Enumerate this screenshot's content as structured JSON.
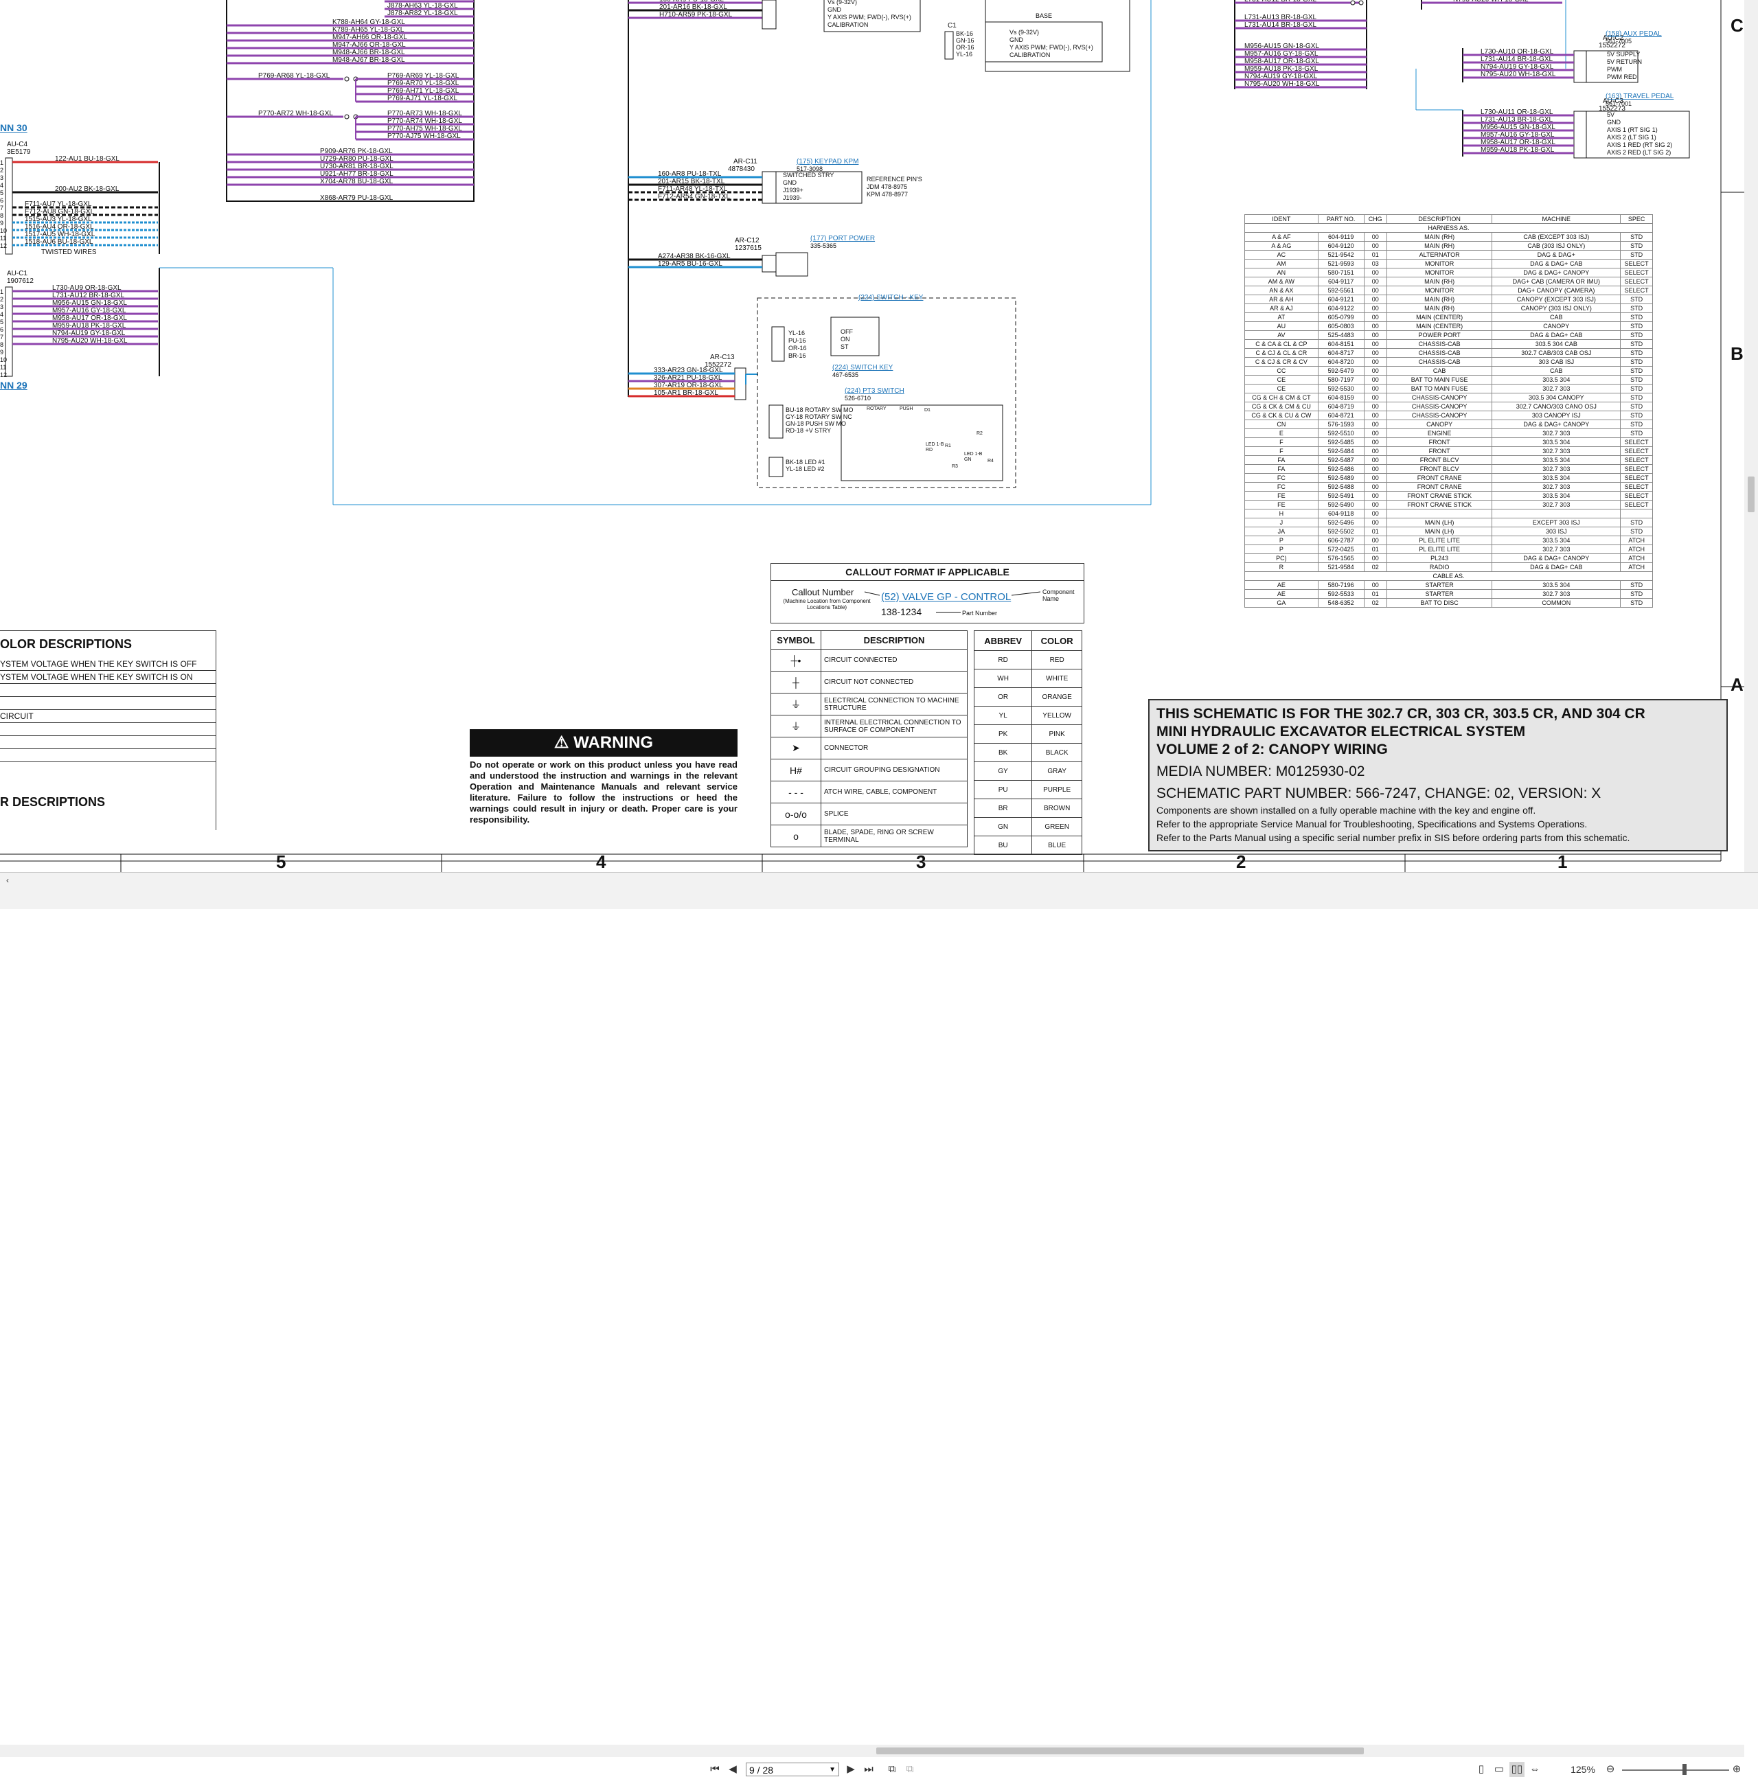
{
  "viewer": {
    "page_current": "9 / 28",
    "zoom": "125%"
  },
  "zones": {
    "columns": [
      "5",
      "4",
      "3",
      "2",
      "1"
    ],
    "rows": [
      "C",
      "B",
      "A"
    ]
  },
  "colors": {
    "purple": "#8e44ad",
    "red": "#d62b2b",
    "blue_wire": "#1f8fd0",
    "orange": "#e08020",
    "link": "#1b73b8"
  },
  "diagram": {
    "conn30": "NN 30",
    "conn29": "NN 29",
    "auc4": {
      "name": "AU-C4",
      "pn": "3E5179"
    },
    "auc1": {
      "name": "AU-C1",
      "pn": "1907612"
    },
    "auc4_wires": [
      "122-AU1 BU-18-GXL",
      "200-AU2 BK-18-GXL",
      "F711-AU7 YL-18-GXL",
      "F712-AU8 GN-18-GXL",
      "1515-AU3 YL-18-GXL",
      "1516-AU4 OR-18-GXL",
      "1517-AU5 WH-18-GXL",
      "1518-AU6 BU-18-GXL"
    ],
    "twisted": "TWISTED WIRES",
    "auc1_wires": [
      "L730-AU9 OR-18-GXL",
      "L731-AU12 BR-18-GXL",
      "M956-AU15 GN-18-GXL",
      "M957-AU16 GY-18-GXL",
      "M958-AU17 OR-18-GXL",
      "M959-AU18 PK-18-GXL",
      "N794-AU19 GY-18-GXL",
      "N795-AU20 WH-18-GXL"
    ],
    "bundle_top": [
      "J878-AR62 BR-18-GXL",
      "J878-AH63 YL-18-GXL",
      "J878-AR82 YL-18-GXL"
    ],
    "bundle_k": [
      "K788-AH64 GY-18-GXL",
      "K789-AH65 YL-18-GXL",
      "M947-AH66 OR-18-GXL",
      "M947-AJ66 OR-18-GXL",
      "M948-AJ66 BR-18-GXL",
      "M948-AJ67 BR-18-GXL"
    ],
    "p769_in": "P769-AR68 YL-18-GXL",
    "p769_out": [
      "P769-AR69 YL-18-GXL",
      "P769-AR70 YL-18-GXL",
      "P769-AH71 YL-18-GXL",
      "P769-AJ71 YL-18-GXL"
    ],
    "p770_in": "P770-AR72 WH-18-GXL",
    "p770_out": [
      "P770-AR73 WH-18-GXL",
      "P770-AR74 WH-18-GXL",
      "P770-AH75 WH-18-GXL",
      "P770-AJ75 WH-18-GXL"
    ],
    "bundle_p909": [
      "P909-AR76 PK-18-GXL",
      "U729-AR80 PU-18-GXL",
      "U730-AR81 BR-18-GXL",
      "U921-AH77 BR-18-GXL",
      "X704-AR78 BU-18-GXL"
    ],
    "x868": "X868-AR79 PU-18-GXL",
    "top_mid": [
      "160-AR9 PU-18-GXL",
      "201-AR16 BK-18-GXL",
      "H710-AR59 PK-18-GXL"
    ],
    "top_mid_pins": [
      "Vs (9-32V)",
      "GND",
      "Y AXIS PWM; FWD(-), RVS(+)",
      "CALIBRATION"
    ],
    "c1": "C1",
    "c1_pins": [
      "Vs (9-32V)",
      "GND",
      "Y AXIS PWM; FWD(-), RVS(+)",
      "CALIBRATION"
    ],
    "c1_wires": [
      "BK-16",
      "GN-16",
      "OR-16",
      "YL-16"
    ],
    "base": "BASE",
    "arc11": {
      "name": "AR-C11",
      "pn": "4878430",
      "callout": "(175) KEYPAD KPM",
      "callpn": "517-3098"
    },
    "arc11_wires": [
      "160-AR8 PU-18-TXL",
      "201-AR15 BK-18-TXL",
      "F711-AR48 YL-18-TXL",
      "F712-AR54 GN-18-TXL"
    ],
    "arc11_pins": [
      "SWITCHED STRY",
      "GND",
      "J1939+",
      "J1939-"
    ],
    "ref_pins": [
      "REFERENCE PIN'S",
      "JDM 478-8975",
      "KPM 478-8977"
    ],
    "arc12": {
      "name": "AR-C12",
      "pn": "1237615",
      "callout": "(177) PORT POWER",
      "callpn": "335-5365"
    },
    "arc12_wires": [
      "A274-AR38 BK-16-GXL",
      "129-AR5 BU-16-GXL"
    ],
    "arc13": {
      "name": "AR-C13",
      "pn": "1552272"
    },
    "arc13_wires": [
      "333-AR23 GN-18-GXL",
      "326-AR21 PU-18-GXL",
      "307-AR19 OR-18-GXL",
      "105-AR1 BR-18-GXL"
    ],
    "switch_key_box": "(224) SWITCH - KEY",
    "switch_key": {
      "callout": "(224) SWITCH KEY",
      "pn": "467-6535"
    },
    "switch_key_wires": [
      "YL-16",
      "PU-16",
      "OR-16",
      "BR-16"
    ],
    "switch_key_pos": [
      "OFF",
      "ON",
      "ST"
    ],
    "pt3": {
      "callout": "(224) PT3 SWITCH",
      "pn": "526-6710"
    },
    "pt3_wires": [
      "BU-18 ROTARY SW MO",
      "GY-18 ROTARY SW NC",
      "GN-18 PUSH SW MO",
      "RD-18 +V STRY",
      "BK-18 LED #1",
      "YL-18 LED #2"
    ],
    "pt3_labels": [
      "ROTARY",
      "PUSH",
      "R1",
      "R2",
      "R3",
      "R4",
      "D1",
      "LED 1-B RD",
      "LED 1-B GN"
    ],
    "auc2": {
      "name": "AU-C2",
      "pn": "1552272",
      "callout": "(158) AUX PEDAL",
      "callpn": "561-7005"
    },
    "auc2_wires": [
      "L730-AU10 OR-18-GXL",
      "L731-AU14 BR-18-GXL",
      "N794-AU19 GY-18-GXL",
      "N795-AU20 WH-18-GXL"
    ],
    "auc2_pins": [
      "5V SUPPLY",
      "5V RETURN",
      "PWM",
      "PWM RED"
    ],
    "auc3": {
      "name": "AU-C3",
      "pn": "1552273",
      "callout": "(163) TRAVEL PEDAL",
      "callpn": "561-7001"
    },
    "auc3_wires": [
      "L730-AU11 OR-18-GXL",
      "L731-AU13 BR-18-GXL",
      "M956-AU15 GN-18-GXL",
      "M957-AU16 GY-18-GXL",
      "M958-AU17 OR-18-GXL",
      "M959-AU18 PK-18-GXL"
    ],
    "auc3_pins": [
      "5V",
      "GND",
      "AXIS 1 (RT SIG 1)",
      "AXIS 2 (LT SIG 1)",
      "AXIS 1 RED (RT SIG 2)",
      "AXIS 2 RED (LT SIG 2)"
    ],
    "top_right_a": [
      "L731-AU12 BR-18-GXL"
    ],
    "top_right_b": "N795-AU20 WH-18-GXL",
    "right_bundle": [
      "L731-AU13 BR-18-GXL",
      "L731-AU14 BR-18-GXL",
      "M956-AU15 GN-18-GXL",
      "M957-AU16 GY-18-GXL",
      "M958-AU17 OR-18-GXL",
      "M959-AU18 PK-18-GXL",
      "N794-AU19 GY-18-GXL",
      "N795-AU20 WH-18-GXL"
    ]
  },
  "parts_table": {
    "headers": [
      "IDENT",
      "PART NO.",
      "CHG",
      "DESCRIPTION",
      "MACHINE",
      "SPEC"
    ],
    "section_harness": "HARNESS AS.",
    "section_cable": "CABLE AS.",
    "harness": [
      [
        "A & AF",
        "604-9119",
        "00",
        "MAIN (RH)",
        "CAB (EXCEPT 303 ISJ)",
        "STD"
      ],
      [
        "A & AG",
        "604-9120",
        "00",
        "MAIN (RH)",
        "CAB (303 ISJ ONLY)",
        "STD"
      ],
      [
        "AC",
        "521-9542",
        "01",
        "ALTERNATOR",
        "DAG & DAG+",
        "STD"
      ],
      [
        "AM",
        "521-9593",
        "03",
        "MONITOR",
        "DAG & DAG+ CAB",
        "SELECT"
      ],
      [
        "AN",
        "580-7151",
        "00",
        "MONITOR",
        "DAG & DAG+ CANOPY",
        "SELECT"
      ],
      [
        "AM & AW",
        "604-9117",
        "00",
        "MAIN (RH)",
        "DAG+ CAB (CAMERA OR IMU)",
        "SELECT"
      ],
      [
        "AN & AX",
        "592-5561",
        "00",
        "MONITOR",
        "DAG+ CANOPY (CAMERA)",
        "SELECT"
      ],
      [
        "AR & AH",
        "604-9121",
        "00",
        "MAIN (RH)",
        "CANOPY (EXCEPT 303 ISJ)",
        "STD"
      ],
      [
        "AR & AJ",
        "604-9122",
        "00",
        "MAIN (RH)",
        "CANOPY (303 ISJ ONLY)",
        "STD"
      ],
      [
        "AT",
        "605-0799",
        "00",
        "MAIN (CENTER)",
        "CAB",
        "STD"
      ],
      [
        "AU",
        "605-0803",
        "00",
        "MAIN (CENTER)",
        "CANOPY",
        "STD"
      ],
      [
        "AV",
        "525-4483",
        "00",
        "POWER PORT",
        "DAG & DAG+ CAB",
        "STD"
      ],
      [
        "C & CA & CL & CP",
        "604-8151",
        "00",
        "CHASSIS-CAB",
        "303.5 304 CAB",
        "STD"
      ],
      [
        "C & CJ & CL & CR",
        "604-8717",
        "00",
        "CHASSIS-CAB",
        "302.7 CAB/303 CAB OSJ",
        "STD"
      ],
      [
        "C & CJ & CR & CV",
        "604-8720",
        "00",
        "CHASSIS-CAB",
        "303 CAB ISJ",
        "STD"
      ],
      [
        "CC",
        "592-5479",
        "00",
        "CAB",
        "CAB",
        "STD"
      ],
      [
        "CE",
        "580-7197",
        "00",
        "BAT TO MAIN FUSE",
        "303.5 304",
        "STD"
      ],
      [
        "CE",
        "592-5530",
        "00",
        "BAT TO MAIN FUSE",
        "302.7 303",
        "STD"
      ],
      [
        "CG & CH & CM & CT",
        "604-8159",
        "00",
        "CHASSIS-CANOPY",
        "303.5 304 CANOPY",
        "STD"
      ],
      [
        "CG & CK & CM & CU",
        "604-8719",
        "00",
        "CHASSIS-CANOPY",
        "302.7 CANO/303 CANO OSJ",
        "STD"
      ],
      [
        "CG & CK & CU & CW",
        "604-8721",
        "00",
        "CHASSIS-CANOPY",
        "303 CANOPY ISJ",
        "STD"
      ],
      [
        "CN",
        "576-1593",
        "00",
        "CANOPY",
        "DAG & DAG+ CANOPY",
        "STD"
      ],
      [
        "E",
        "592-5510",
        "00",
        "ENGINE",
        "302.7 303",
        "STD"
      ],
      [
        "F",
        "592-5485",
        "00",
        "FRONT",
        "303.5 304",
        "SELECT"
      ],
      [
        "F",
        "592-5484",
        "00",
        "FRONT",
        "302.7 303",
        "SELECT"
      ],
      [
        "FA",
        "592-5487",
        "00",
        "FRONT BLCV",
        "303.5 304",
        "SELECT"
      ],
      [
        "FA",
        "592-5486",
        "00",
        "FRONT BLCV",
        "302.7 303",
        "SELECT"
      ],
      [
        "FC",
        "592-5489",
        "00",
        "FRONT CRANE",
        "303.5 304",
        "SELECT"
      ],
      [
        "FC",
        "592-5488",
        "00",
        "FRONT CRANE",
        "302.7 303",
        "SELECT"
      ],
      [
        "FE",
        "592-5491",
        "00",
        "FRONT CRANE STICK",
        "303.5 304",
        "SELECT"
      ],
      [
        "FE",
        "592-5490",
        "00",
        "FRONT CRANE STICK",
        "302.7 303",
        "SELECT"
      ],
      [
        "H",
        "604-9118",
        "00",
        "",
        "",
        ""
      ],
      [
        "J",
        "592-5496",
        "00",
        "MAIN (LH)",
        "EXCEPT 303 ISJ",
        "STD"
      ],
      [
        "JA",
        "592-5502",
        "01",
        "MAIN (LH)",
        "303 ISJ",
        "STD"
      ],
      [
        "P",
        "606-2787",
        "00",
        "PL ELITE LITE",
        "303.5 304",
        "ATCH"
      ],
      [
        "P",
        "572-0425",
        "01",
        "PL ELITE LITE",
        "302.7 303",
        "ATCH"
      ],
      [
        "PC)",
        "576-1565",
        "00",
        "PL243",
        "DAG & DAG+ CANOPY",
        "ATCH"
      ],
      [
        "R",
        "521-9584",
        "02",
        "RADIO",
        "DAG & DAG+ CAB",
        "ATCH"
      ]
    ],
    "cable": [
      [
        "AE",
        "580-7196",
        "00",
        "STARTER",
        "303.5 304",
        "STD"
      ],
      [
        "AE",
        "592-5533",
        "01",
        "STARTER",
        "302.7 303",
        "STD"
      ],
      [
        "GA",
        "548-6352",
        "02",
        "BAT TO DISC",
        "COMMON",
        "STD"
      ]
    ]
  },
  "callout": {
    "title": "CALLOUT FORMAT IF APPLICABLE",
    "number": "Callout Number",
    "number_sub": "(Machine Location from Component Locations Table)",
    "example": "(52) VALVE GP - CONTROL",
    "component": "Component Name",
    "part": "138-1234",
    "part_label": "Part Number"
  },
  "symbols": {
    "h_symbol": "SYMBOL",
    "h_desc": "DESCRIPTION",
    "rows": [
      {
        "glyph": "┼•",
        "desc": "CIRCUIT CONNECTED"
      },
      {
        "glyph": "┼",
        "desc": "CIRCUIT NOT CONNECTED"
      },
      {
        "glyph": "⏚",
        "desc": "ELECTRICAL CONNECTION TO MACHINE STRUCTURE"
      },
      {
        "glyph": "⏚",
        "desc": "INTERNAL ELECTRICAL CONNECTION TO SURFACE OF COMPONENT"
      },
      {
        "glyph": "➤",
        "desc": "CONNECTOR"
      },
      {
        "glyph": "H#",
        "desc": "CIRCUIT GROUPING DESIGNATION"
      },
      {
        "glyph": "- - -",
        "desc": "ATCH WIRE, CABLE, COMPONENT"
      },
      {
        "glyph": "o-o/o",
        "desc": "SPLICE"
      },
      {
        "glyph": "o",
        "desc": "BLADE, SPADE, RING OR SCREW TERMINAL"
      }
    ]
  },
  "abbrev": {
    "h_abbrev": "ABBREV",
    "h_color": "COLOR",
    "rows": [
      [
        "RD",
        "RED"
      ],
      [
        "WH",
        "WHITE"
      ],
      [
        "OR",
        "ORANGE"
      ],
      [
        "YL",
        "YELLOW"
      ],
      [
        "PK",
        "PINK"
      ],
      [
        "BK",
        "BLACK"
      ],
      [
        "GY",
        "GRAY"
      ],
      [
        "PU",
        "PURPLE"
      ],
      [
        "BR",
        "BROWN"
      ],
      [
        "GN",
        "GREEN"
      ],
      [
        "BU",
        "BLUE"
      ]
    ]
  },
  "warning": {
    "title": "WARNING",
    "text": "Do not operate or work on this product unless you have read and understood the instruction and warnings in the relevant Operation and Maintenance Manuals and relevant service literature. Failure to follow the instructions or heed the warnings could result in injury or death. Proper care is your responsibility."
  },
  "color_desc": {
    "title": "OLOR DESCRIPTIONS",
    "lines": [
      "YSTEM VOLTAGE WHEN THE KEY SWITCH IS OFF",
      "YSTEM VOLTAGE WHEN THE KEY SWITCH IS ON",
      "",
      "",
      "CIRCUIT",
      "",
      "",
      ""
    ],
    "title2": "R DESCRIPTIONS"
  },
  "title_block": {
    "l1": "THIS SCHEMATIC IS FOR THE 302.7 CR, 303 CR, 303.5 CR, AND 304 CR",
    "l2": "MINI HYDRAULIC EXCAVATOR ELECTRICAL SYSTEM",
    "l3": "VOLUME 2 of 2: CANOPY WIRING",
    "media": "MEDIA NUMBER: M0125930-02",
    "part": "SCHEMATIC PART NUMBER: 566-7247, CHANGE: 02, VERSION: X",
    "n1": "Components are shown installed on a fully operable machine with the key and engine off.",
    "n2": "Refer to the appropriate Service Manual for Troubleshooting, Specifications and Systems Operations.",
    "n3": "Refer to the Parts Manual using a specific serial number prefix in SIS before ordering parts from this schematic."
  }
}
